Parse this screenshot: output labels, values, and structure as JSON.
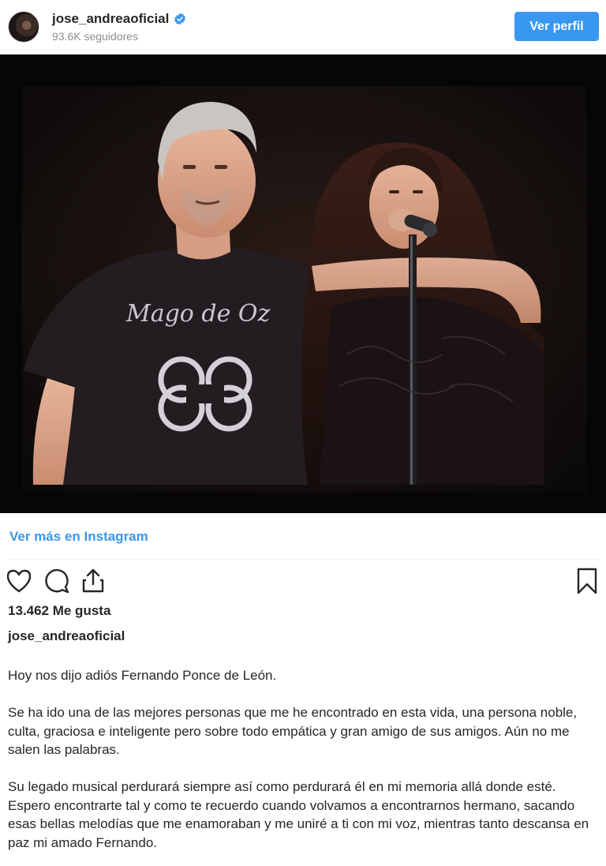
{
  "header": {
    "username": "jose_andreaoficial",
    "followers": "93.6K seguidores",
    "view_profile_label": "Ver perfil"
  },
  "post": {
    "shirt_text": "Mago de Oz",
    "view_more_label": "Ver más en Instagram",
    "likes": "13.462 Me gusta",
    "caption_user": "jose_andreaoficial",
    "caption_paragraphs": [
      "Hoy nos dijo adiós Fernando Ponce de León.",
      "Se ha ido una de las mejores personas que me he encontrado en esta vida, una persona noble, culta, graciosa e inteligente pero sobre todo empática y gran amigo de sus amigos. Aún no me salen las palabras.",
      "Su legado musical perdurará siempre así como perdurará él en mi memoria allá donde esté. Espero encontrarte tal y como te recuerdo cuando volvamos a encontrarnos hermano, sacando esas bellas melodías que me enamoraban y me uniré a ti con mi voz, mientras tanto descansa en paz mi amado Fernando."
    ]
  },
  "icons": {
    "verified": "verified-badge-icon",
    "like": "heart-icon",
    "comment": "comment-icon",
    "share": "share-icon",
    "save": "bookmark-icon"
  },
  "colors": {
    "accent": "#3897f0",
    "text": "#262626",
    "muted": "#8e8e8e"
  }
}
